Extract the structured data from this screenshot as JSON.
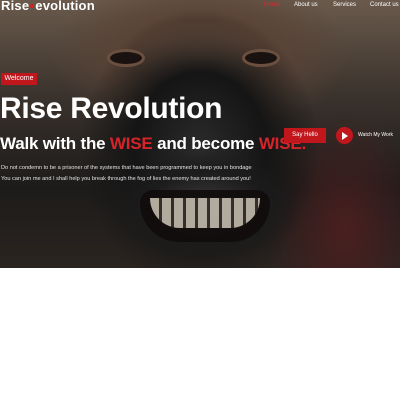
{
  "brand": {
    "logo_text_1": "Rise",
    "logo_text_2": "evolution"
  },
  "nav": {
    "items": [
      {
        "label": "Home",
        "active": true
      },
      {
        "label": "About us",
        "active": false
      },
      {
        "label": "Services",
        "active": false
      },
      {
        "label": "Contact us",
        "active": false
      }
    ]
  },
  "hero": {
    "badge": "Welcome",
    "title": "Rise Revolution",
    "subtitle_1": "Walk with the ",
    "subtitle_wise_1": "WISE",
    "subtitle_2": " and become ",
    "subtitle_wise_2": "WISE.",
    "description_line_1": "Do not condemn to be a prisoner of the systems that have been programmed to keep you in bondage",
    "description_line_2": "You can join me and I shall help you break through the fog of lies the enemy has created around you!",
    "cta_label": "Say Hello",
    "watch_label": "Watch My Work"
  },
  "colors": {
    "accent": "#c0161c",
    "accent_text": "#d7232a",
    "text": "#ffffff",
    "page_background": "#ffffff"
  },
  "icons": {
    "play": "play-icon"
  }
}
